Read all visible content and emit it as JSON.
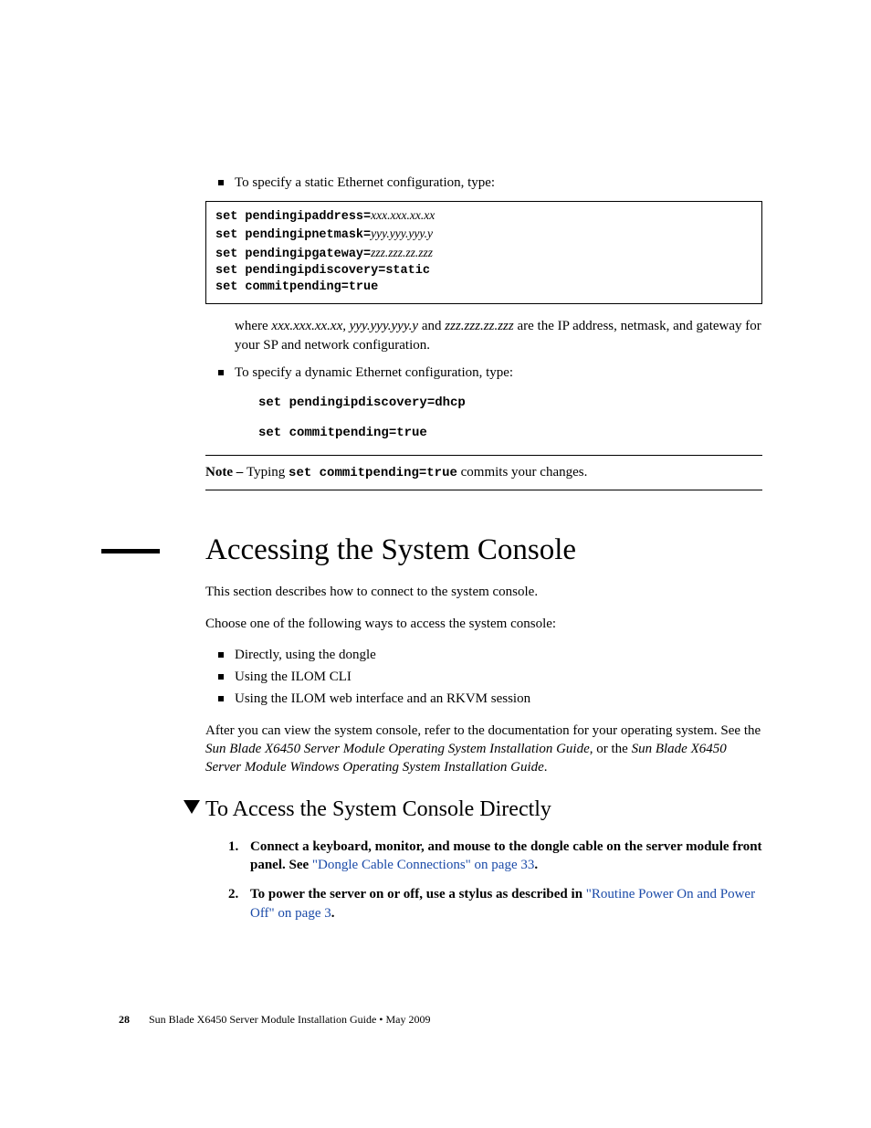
{
  "bullet_static": "To specify a static Ethernet configuration, type:",
  "codebox": {
    "l1a": "set pendingipaddress=",
    "l1b": "xxx.xxx.xx.xx",
    "l2a": "set pendingipnetmask=",
    "l2b": "yyy.yyy.yyy.y",
    "l3a": "set pendingipgateway=",
    "l3b": "zzz.zzz.zz.zzz",
    "l4": "set pendingipdiscovery=static",
    "l5": "set commitpending=true"
  },
  "where_text": {
    "pre": "where ",
    "v1": "xxx.xxx.xx.xx,",
    "v2": " yyy.yyy.yyy.y ",
    "mid": "and ",
    "v3": "zzz.zzz.zz.zzz ",
    "post": "are the IP address, netmask, and gateway for your SP and network configuration."
  },
  "bullet_dynamic": "To specify a dynamic Ethernet configuration, type:",
  "cmd1": "set pendingipdiscovery=dhcp",
  "cmd2": "set commitpending=true",
  "note": {
    "label": "Note – ",
    "pre": "Typing ",
    "code": "set commitpending=true",
    "post": " commits your changes."
  },
  "section_title": "Accessing the System Console",
  "intro1": "This section describes how to connect to the system console.",
  "intro2": "Choose one of the following ways to access the system console:",
  "ways": [
    "Directly, using the dongle",
    "Using the ILOM CLI",
    "Using the ILOM web interface and an RKVM session"
  ],
  "after": {
    "pre": "After you can view the system console, refer to the documentation for your operating system. See the ",
    "g1": "Sun Blade X6450 Server Module Operating System Installation Guide",
    "mid": ", or the ",
    "g2": "Sun Blade X6450 Server Module Windows Operating System Installation Guide",
    "post": "."
  },
  "proc_title": "To Access the System Console Directly",
  "steps": [
    {
      "pre": "Connect a keyboard, monitor, and mouse to the dongle cable on the server module front panel. See ",
      "link": "\"Dongle Cable Connections\" on page 33",
      "post": "."
    },
    {
      "pre": "To power the server on or off, use a stylus as described in ",
      "link": "\"Routine Power On and Power Off\" on page 3",
      "post": "."
    }
  ],
  "footer": {
    "page": "28",
    "title": "Sun Blade X6450 Server Module Installation Guide  •  May 2009"
  }
}
